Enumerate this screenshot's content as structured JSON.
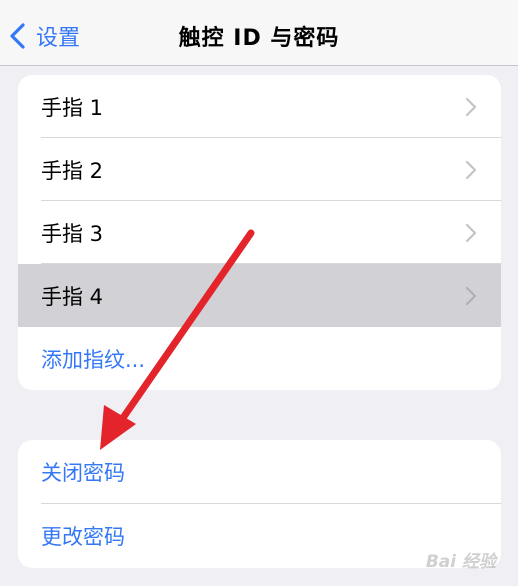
{
  "nav": {
    "back_label": "设置",
    "title": "触控 ID 与密码"
  },
  "fingerprints": {
    "items": [
      {
        "label": "手指 1",
        "highlighted": false
      },
      {
        "label": "手指 2",
        "highlighted": false
      },
      {
        "label": "手指 3",
        "highlighted": false
      },
      {
        "label": "手指 4",
        "highlighted": true
      }
    ],
    "add_label": "添加指纹..."
  },
  "passcode": {
    "turn_off_label": "关闭密码",
    "change_label": "更改密码"
  },
  "annotation": {
    "arrow_color": "#e3242b",
    "icon": "red-arrow-icon"
  },
  "watermark": "Bai 经验"
}
